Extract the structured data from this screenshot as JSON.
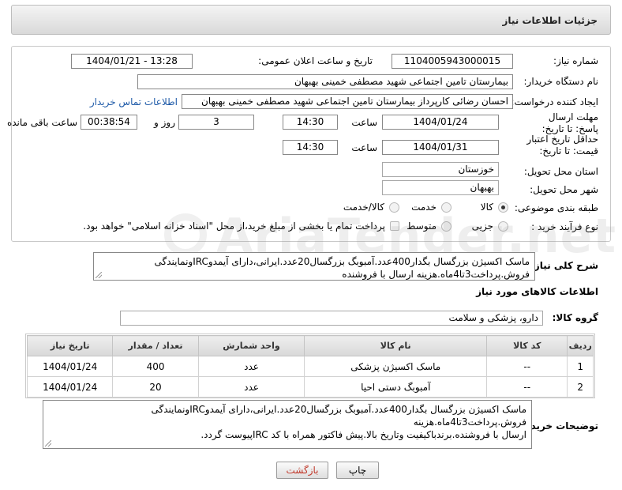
{
  "header": {
    "title": "جزئیات اطلاعات نیاز"
  },
  "form": {
    "need_number": {
      "label": "شماره نیاز:",
      "value": "1104005943000015"
    },
    "announce": {
      "label": "تاریخ و ساعت اعلان عمومی:",
      "value": "1404/01/21 - 13:28"
    },
    "buyer_org": {
      "label": "نام دستگاه خریدار:",
      "value": "بیمارستان تامین اجتماعی شهید مصطفی خمینی بهبهان"
    },
    "requester": {
      "label": "ایجاد کننده درخواست:",
      "value": "احسان رضائی کارپرداز بیمارستان تامین اجتماعی شهید مصطفی خمینی بهبهان",
      "contact_link": "اطلاعات تماس خریدار"
    },
    "reply_deadline": {
      "label": "مهلت ارسال پاسخ: تا تاریخ:",
      "date": "1404/01/24",
      "time_label": "ساعت",
      "time": "14:30",
      "days": "3",
      "days_label": "روز و",
      "remaining": "00:38:54",
      "remaining_label": "ساعت باقی مانده"
    },
    "price_validity": {
      "label": "حداقل تاریخ اعتبار قیمت: تا تاریخ:",
      "date": "1404/01/31",
      "time_label": "ساعت",
      "time": "14:30"
    },
    "province": {
      "label": "استان محل تحویل:",
      "value": "خوزستان"
    },
    "city": {
      "label": "شهر محل تحویل:",
      "value": "بهبهان"
    },
    "category": {
      "label": "طبقه بندی موضوعی:",
      "options": [
        "کالا",
        "خدمت",
        "کالا/خدمت"
      ],
      "selected": "کالا"
    },
    "process": {
      "label": "نوع فرآیند خرید :",
      "options": [
        "جزیی",
        "متوسط"
      ],
      "selected": "جزیی",
      "payment_note": "پرداخت تمام یا بخشی از مبلغ خرید،از محل \"اسناد خزانه اسلامی\" خواهد بود."
    }
  },
  "general_description": {
    "label": "شرح کلی نیاز:",
    "line1": "ماسک اکسیژن بزرگسال بگدار400عدد.آمبوبگ بزرگسال20عدد.ایرانی،دارای آیمدوIRCونمایندگی",
    "line2": "فروش.پرداخت3تا4ماه.هزینه ارسال با فروشنده"
  },
  "items_section": {
    "title": "اطلاعات کالاهای مورد نیاز",
    "group_label": "گروه کالا:",
    "group_value": "دارو، پزشکی و سلامت",
    "columns": [
      "ردیف",
      "کد کالا",
      "نام کالا",
      "واحد شمارش",
      "تعداد / مقدار",
      "تاریخ نیاز"
    ],
    "rows": [
      {
        "row": "1",
        "code": "--",
        "name": "ماسک اکسیژن پزشکی",
        "unit": "عدد",
        "qty": "400",
        "date": "1404/01/24"
      },
      {
        "row": "2",
        "code": "--",
        "name": "آمبوبگ دستی احیا",
        "unit": "عدد",
        "qty": "20",
        "date": "1404/01/24"
      }
    ]
  },
  "buyer_notes": {
    "label": "توضیحات خریدار:",
    "line1": "ماسک اکسیژن بزرگسال بگدار400عدد.آمبوبگ بزرگسال20عدد.ایرانی،دارای آیمدوIRCونمایندگی فروش.پرداخت3تا4ماه.هزینه",
    "line2": "ارسال با فروشنده.برندباکیفیت وتاریخ بالا.پیش فاکتور همراه با کد IRCپیوست گردد."
  },
  "buttons": {
    "print": "چاپ",
    "back": "بازگشت"
  },
  "colors": {
    "link": "#1e5aa8",
    "back_text": "#c0392b"
  }
}
